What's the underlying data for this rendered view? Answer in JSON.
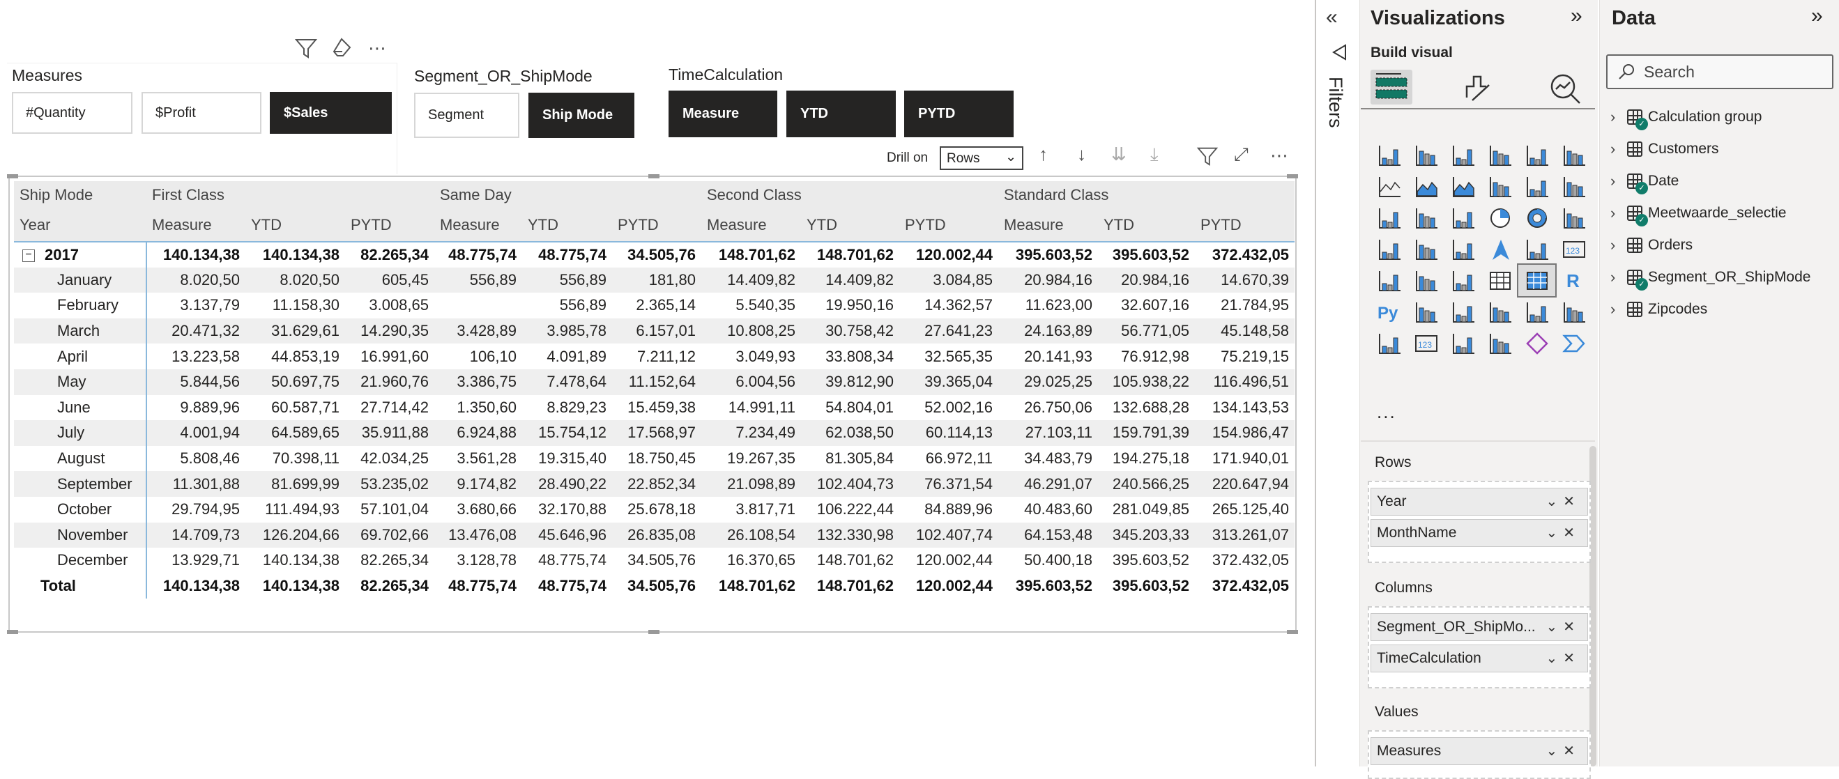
{
  "slicers": {
    "measures": {
      "title": "Measures",
      "options": [
        "#Quantity",
        "$Profit",
        "$Sales"
      ],
      "selected": "$Sales"
    },
    "segment": {
      "title": "Segment_OR_ShipMode",
      "options": [
        "Segment",
        "Ship Mode"
      ],
      "selected": "Ship Mode"
    },
    "time": {
      "title": "TimeCalculation",
      "options": [
        "Measure",
        "YTD",
        "PYTD"
      ],
      "selected": [
        "Measure",
        "YTD",
        "PYTD"
      ]
    },
    "header_icons": [
      "filter-icon",
      "eraser-icon",
      "more-options-icon"
    ]
  },
  "visual_header": {
    "drill_on_label": "Drill on",
    "drill_on_value": "Rows"
  },
  "matrix": {
    "row_header_1": "Ship Mode",
    "row_header_2": "Year",
    "groups": [
      "First Class",
      "Same Day",
      "Second Class",
      "Standard Class"
    ],
    "sub_columns": [
      "Measure",
      "YTD",
      "PYTD"
    ],
    "rows": [
      {
        "label": "2017",
        "type": "year",
        "values": [
          "140.134,38",
          "140.134,38",
          "82.265,34",
          "48.775,74",
          "48.775,74",
          "34.505,76",
          "148.701,62",
          "148.701,62",
          "120.002,44",
          "395.603,52",
          "395.603,52",
          "372.432,05"
        ]
      },
      {
        "label": "January",
        "values": [
          "8.020,50",
          "8.020,50",
          "605,45",
          "556,89",
          "556,89",
          "181,80",
          "14.409,82",
          "14.409,82",
          "3.084,85",
          "20.984,16",
          "20.984,16",
          "14.670,39"
        ]
      },
      {
        "label": "February",
        "values": [
          "3.137,79",
          "11.158,30",
          "3.008,65",
          "",
          "556,89",
          "2.365,14",
          "5.540,35",
          "19.950,16",
          "14.362,57",
          "11.623,00",
          "32.607,16",
          "21.784,95"
        ]
      },
      {
        "label": "March",
        "values": [
          "20.471,32",
          "31.629,61",
          "14.290,35",
          "3.428,89",
          "3.985,78",
          "6.157,01",
          "10.808,25",
          "30.758,42",
          "27.641,23",
          "24.163,89",
          "56.771,05",
          "45.148,58"
        ]
      },
      {
        "label": "April",
        "values": [
          "13.223,58",
          "44.853,19",
          "16.991,60",
          "106,10",
          "4.091,89",
          "7.211,12",
          "3.049,93",
          "33.808,34",
          "32.565,35",
          "20.141,93",
          "76.912,98",
          "75.219,15"
        ]
      },
      {
        "label": "May",
        "values": [
          "5.844,56",
          "50.697,75",
          "21.960,76",
          "3.386,75",
          "7.478,64",
          "11.152,64",
          "6.004,56",
          "39.812,90",
          "39.365,04",
          "29.025,25",
          "105.938,22",
          "116.496,51"
        ]
      },
      {
        "label": "June",
        "values": [
          "9.889,96",
          "60.587,71",
          "27.714,42",
          "1.350,60",
          "8.829,23",
          "15.459,38",
          "14.991,11",
          "54.804,01",
          "52.002,16",
          "26.750,06",
          "132.688,28",
          "134.143,53"
        ]
      },
      {
        "label": "July",
        "values": [
          "4.001,94",
          "64.589,65",
          "35.911,88",
          "6.924,88",
          "15.754,12",
          "17.568,97",
          "7.234,49",
          "62.038,50",
          "60.114,13",
          "27.103,11",
          "159.791,39",
          "154.986,47"
        ]
      },
      {
        "label": "August",
        "values": [
          "5.808,46",
          "70.398,11",
          "42.034,25",
          "3.561,28",
          "19.315,40",
          "18.750,45",
          "19.267,35",
          "81.305,84",
          "66.972,11",
          "34.483,79",
          "194.275,18",
          "171.940,01"
        ]
      },
      {
        "label": "September",
        "values": [
          "11.301,88",
          "81.699,99",
          "53.235,02",
          "9.174,82",
          "28.490,22",
          "22.852,34",
          "21.098,89",
          "102.404,73",
          "76.371,54",
          "46.291,07",
          "240.566,25",
          "220.647,94"
        ]
      },
      {
        "label": "October",
        "values": [
          "29.794,95",
          "111.494,93",
          "57.101,04",
          "3.680,66",
          "32.170,88",
          "25.678,18",
          "3.817,71",
          "106.222,44",
          "84.889,96",
          "40.483,60",
          "281.049,85",
          "265.125,40"
        ]
      },
      {
        "label": "November",
        "values": [
          "14.709,73",
          "126.204,66",
          "69.702,66",
          "13.476,08",
          "45.646,96",
          "26.835,08",
          "26.108,54",
          "132.330,98",
          "102.407,74",
          "64.153,48",
          "345.203,33",
          "313.261,07"
        ]
      },
      {
        "label": "December",
        "values": [
          "13.929,71",
          "140.134,38",
          "82.265,34",
          "3.128,78",
          "48.775,74",
          "34.505,76",
          "16.370,65",
          "148.701,62",
          "120.002,44",
          "50.400,18",
          "395.603,52",
          "372.432,05"
        ]
      },
      {
        "label": "Total",
        "type": "total",
        "values": [
          "140.134,38",
          "140.134,38",
          "82.265,34",
          "48.775,74",
          "48.775,74",
          "34.505,76",
          "148.701,62",
          "148.701,62",
          "120.002,44",
          "395.603,52",
          "395.603,52",
          "372.432,05"
        ]
      }
    ]
  },
  "filters_pane": {
    "label": "Filters"
  },
  "visualizations": {
    "title": "Visualizations",
    "build_visual": "Build visual",
    "more": "...",
    "gallery": [
      "stacked-bar",
      "stacked-column",
      "clustered-bar",
      "clustered-column",
      "100-stacked-bar",
      "100-stacked-column",
      "line",
      "area",
      "stacked-area",
      "line-stacked-column",
      "line-clustered-column",
      "ribbon",
      "waterfall",
      "funnel",
      "scatter",
      "pie",
      "donut",
      "treemap",
      "map",
      "filled-map",
      "shape-map",
      "azure-map",
      "gauge",
      "card",
      "multi-row-card",
      "kpi",
      "slicer",
      "table",
      "matrix",
      "r-visual",
      "python-visual",
      "key-influencers",
      "decomposition-tree",
      "qa",
      "smart-narrative",
      "metrics",
      "paginated-report",
      "card-new",
      "slicer-new",
      "arcgis-map",
      "power-apps",
      "power-automate"
    ],
    "selected": "matrix",
    "wells": {
      "rows_label": "Rows",
      "rows": [
        "Year",
        "MonthName"
      ],
      "columns_label": "Columns",
      "columns": [
        "Segment_OR_ShipMo...",
        "TimeCalculation"
      ],
      "values_label": "Values",
      "values": [
        "Measures"
      ]
    }
  },
  "data_pane": {
    "title": "Data",
    "search_placeholder": "Search",
    "items": [
      {
        "label": "Calculation group",
        "icon": "calculation-group-icon",
        "checked": true
      },
      {
        "label": "Customers",
        "icon": "table-icon",
        "checked": false
      },
      {
        "label": "Date",
        "icon": "table-icon",
        "checked": true
      },
      {
        "label": "Meetwaarde_selectie",
        "icon": "parameter-table-icon",
        "checked": true
      },
      {
        "label": "Orders",
        "icon": "table-icon",
        "checked": false
      },
      {
        "label": "Segment_OR_ShipMode",
        "icon": "parameter-table-icon",
        "checked": true
      },
      {
        "label": "Zipcodes",
        "icon": "table-icon",
        "checked": false
      }
    ]
  },
  "colors": {
    "selected_chip": "#252423",
    "accent_blue": "#118dff",
    "check_green": "#107c6a",
    "pane_bg": "#f3f2f1"
  }
}
